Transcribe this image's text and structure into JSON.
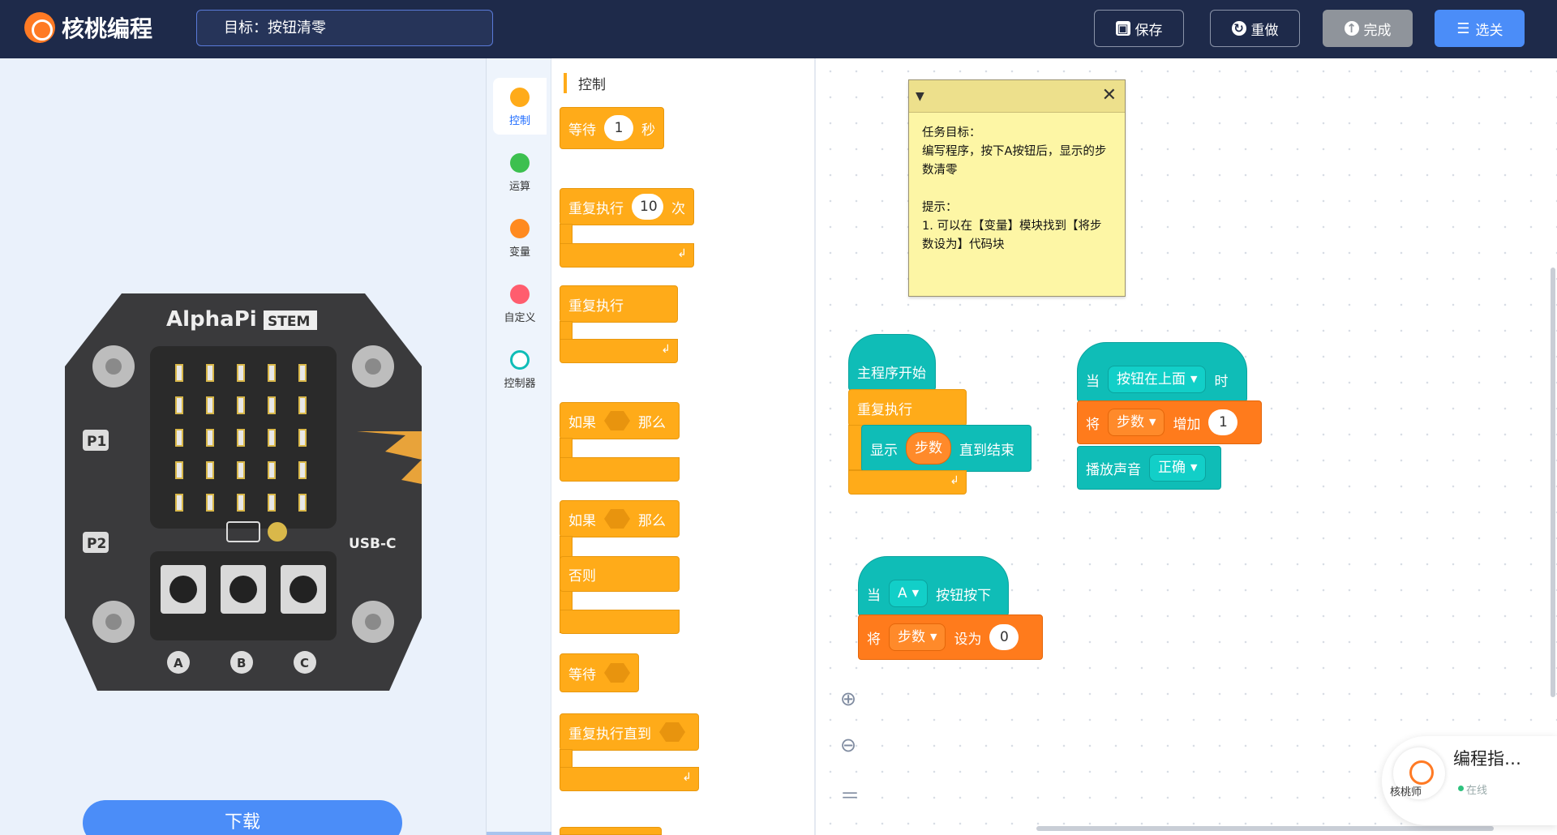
{
  "app": {
    "logo_text": "核桃编程"
  },
  "goal": {
    "text": "目标：按钮清零"
  },
  "toolbar": {
    "save": "保存",
    "redo": "重做",
    "done": "完成",
    "levels": "选关"
  },
  "left": {
    "download": "下载",
    "board": {
      "brand": "AlphaPi",
      "badge": "STEM",
      "p1": "P1",
      "p2": "P2",
      "usb": "USB-C",
      "btn_a": "A",
      "btn_b": "B",
      "btn_c": "C"
    }
  },
  "categories": [
    {
      "label": "控制",
      "color": "#ffab19"
    },
    {
      "label": "运算",
      "color": "#3cc04f"
    },
    {
      "label": "变量",
      "color": "#ff8a1f"
    },
    {
      "label": "自定义",
      "color": "#ff5d6e"
    },
    {
      "label": "控制器",
      "color": "#0fbdb7"
    }
  ],
  "palette": {
    "title": "控制",
    "wait": {
      "a": "等待",
      "v": "1",
      "b": "秒"
    },
    "repeat_n": {
      "a": "重复执行",
      "v": "10",
      "b": "次"
    },
    "forever": {
      "a": "重复执行"
    },
    "if1": {
      "a": "如果",
      "b": "那么"
    },
    "if2": {
      "a": "如果",
      "b": "那么",
      "else": "否则"
    },
    "wait_until": {
      "a": "等待"
    },
    "repeat_until": {
      "a": "重复执行直到"
    }
  },
  "note": {
    "body": "任务目标：\n编写程序，按下A按钮后，显示的步数清零\n\n提示：\n1. 可以在【变量】模块找到【将步数设为】代码块"
  },
  "script1": {
    "hat": "主程序开始",
    "loop": "重复执行",
    "show": "显示",
    "var": "步数",
    "until": "直到结束"
  },
  "script2": {
    "when": "当",
    "cond": "按钮在上面",
    "then": "时",
    "set": "将",
    "var": "步数",
    "inc": "增加",
    "val": "1",
    "sound": "播放声音",
    "sound_val": "正确"
  },
  "script3": {
    "when": "当",
    "btn": "A",
    "pressed": "按钮按下",
    "set": "将",
    "var": "步数",
    "setto": "设为",
    "val": "0"
  },
  "guide": {
    "name": "编程指…",
    "status": "在线",
    "sub": "核桃师"
  }
}
